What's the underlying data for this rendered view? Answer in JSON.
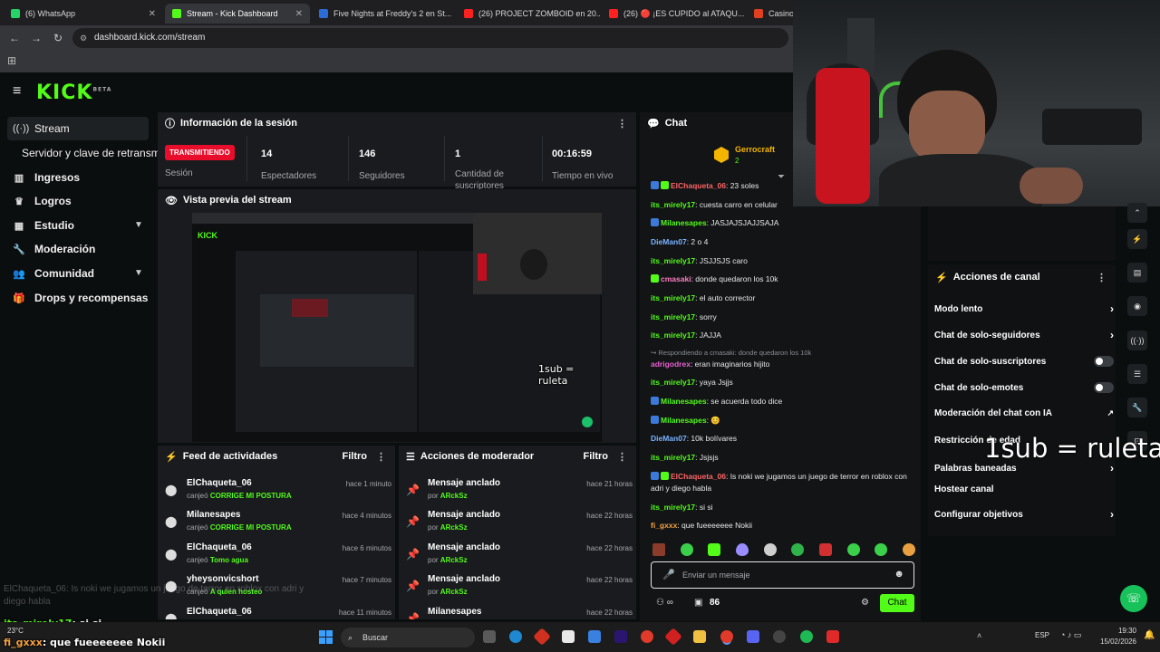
{
  "browser": {
    "tabs": [
      {
        "title": "(6) WhatsApp",
        "color": "#25d366"
      },
      {
        "title": "Stream - Kick Dashboard",
        "color": "#53fc18"
      },
      {
        "title": "Five Nights at Freddy's 2 en St...",
        "color": "#2a6cd8"
      },
      {
        "title": "(26) PROJECT ZOMBOID en 20...",
        "color": "#ff2020"
      },
      {
        "title": "(26) 🔴 ¡ES CUPIDO al ATAQU...",
        "color": "#ff2020"
      },
      {
        "title": "Casino Or",
        "color": "#e04020"
      }
    ],
    "url": "dashboard.kick.com/stream"
  },
  "kick": {
    "logo": "KICK",
    "beta": "BETA"
  },
  "sidebar": {
    "items": [
      {
        "label": "Stream",
        "icon": "broadcast-icon"
      },
      {
        "label": "Servidor y clave de retransmisión",
        "icon": ""
      },
      {
        "label": "Ingresos",
        "icon": "bank-icon"
      },
      {
        "label": "Logros",
        "icon": "trophy-icon"
      },
      {
        "label": "Estudio",
        "icon": "studio-icon"
      },
      {
        "label": "Moderación",
        "icon": "wrench-icon"
      },
      {
        "label": "Comunidad",
        "icon": "people-icon"
      },
      {
        "label": "Drops y recompensas",
        "icon": "gift-icon"
      }
    ]
  },
  "session": {
    "title": "Información de la sesión",
    "live_badge": "TRANSMITIENDO",
    "live_label": "Sesión",
    "stats": [
      {
        "value": "14",
        "label": "Espectadores"
      },
      {
        "value": "146",
        "label": "Seguidores"
      },
      {
        "value": "1",
        "label": "Cantidad de suscriptores"
      },
      {
        "value": "00:16:59",
        "label": "Tiempo en vivo"
      }
    ]
  },
  "preview": {
    "title": "Vista previa del stream",
    "overlay_text": "1sub = ruleta"
  },
  "feed": {
    "title": "Feed de actividades",
    "filter": "Filtro",
    "rows": [
      {
        "name": "ElChaqueta_06",
        "time": "hace 1 minuto",
        "action": "canjeó",
        "reward": "CORRIGE MI POSTURA"
      },
      {
        "name": "Milanesapes",
        "time": "hace 4 minutos",
        "action": "canjeó",
        "reward": "CORRIGE MI POSTURA"
      },
      {
        "name": "ElChaqueta_06",
        "time": "hace 6 minutos",
        "action": "canjeó",
        "reward": "Tomo agua"
      },
      {
        "name": "yheysonvicshort",
        "time": "hace 7 minutos",
        "action": "canjeó",
        "reward": "A quien hosteo"
      },
      {
        "name": "ElChaqueta_06",
        "time": "hace 11 minutos",
        "action": "",
        "reward": ""
      }
    ]
  },
  "modactions": {
    "title": "Acciones de moderador",
    "filter": "Filtro",
    "rows": [
      {
        "name": "Mensaje anclado",
        "time": "hace 21 horas",
        "by": "por",
        "user": "ARckSz"
      },
      {
        "name": "Mensaje anclado",
        "time": "hace 22 horas",
        "by": "por",
        "user": "ARckSz"
      },
      {
        "name": "Mensaje anclado",
        "time": "hace 22 horas",
        "by": "por",
        "user": "ARckSz"
      },
      {
        "name": "Mensaje anclado",
        "time": "hace 22 horas",
        "by": "por",
        "user": "ARckSz"
      },
      {
        "name": "Milanesapes",
        "time": "hace 22 horas",
        "by": "",
        "user": ""
      }
    ]
  },
  "chat": {
    "title": "Chat",
    "pinned_user": "Gerrocraft",
    "pinned_count": "2",
    "messages": [
      {
        "user": "ElChaqueta_06",
        "text": "23 soles",
        "cls": "r"
      },
      {
        "user": "its_mirely17",
        "text": "cuesta carro en celular",
        "cls": "g"
      },
      {
        "user": "Milanesapes",
        "text": "JASJAJSJAJJSAJA",
        "cls": "g"
      },
      {
        "user": "DieMan07",
        "text": "2 o 4",
        "cls": "b"
      },
      {
        "user": "its_mirely17",
        "text": "JSJJSJS caro",
        "cls": "g"
      },
      {
        "user": "cmasaki",
        "text": "donde quedaron los 10k",
        "cls": "pk"
      },
      {
        "user": "its_mirely17",
        "text": "el auto corrector",
        "cls": "g"
      },
      {
        "user": "its_mirely17",
        "text": "sorry",
        "cls": "g"
      },
      {
        "user": "its_mirely17",
        "text": "JAJJA",
        "cls": "g"
      },
      {
        "user": "adrigodrex",
        "text": "eran imaginarios hijito",
        "cls": "p"
      },
      {
        "user": "its_mirely17",
        "text": "yaya Jsjjs",
        "cls": "g"
      },
      {
        "user": "Milanesapes",
        "text": "se acuerda todo dice",
        "cls": "g"
      },
      {
        "user": "Milanesapes",
        "text": "😊",
        "cls": "g"
      },
      {
        "user": "DieMan07",
        "text": "10k bolívares",
        "cls": "b"
      },
      {
        "user": "its_mirely17",
        "text": "Jsjsjs",
        "cls": "g"
      },
      {
        "user": "ElChaqueta_06",
        "text": "Is noki we jugamos un juego de terror en roblox con adri y diego habla",
        "cls": "r"
      },
      {
        "user": "its_mirely17",
        "text": "si si",
        "cls": "g"
      },
      {
        "user": "fi_gxxx",
        "text": "que fueeeeeee Nokii",
        "cls": "o"
      }
    ],
    "reply_to": "Respondiendo a cmasaki: donde quedaron los 10k",
    "input_placeholder": "Enviar un mensaje",
    "points": "86",
    "send": "Chat"
  },
  "actions": {
    "title": "Acciones de canal",
    "items": [
      {
        "label": "Modo lento",
        "kind": "arrow"
      },
      {
        "label": "Chat de solo-seguidores",
        "kind": "arrow"
      },
      {
        "label": "Chat de solo-suscriptores",
        "kind": "toggle"
      },
      {
        "label": "Chat de solo-emotes",
        "kind": "toggle"
      },
      {
        "label": "Moderación del chat con IA",
        "kind": "link"
      },
      {
        "label": "Restricción de edad",
        "kind": "toggle"
      },
      {
        "label": "Palabras baneadas",
        "kind": "arrow"
      },
      {
        "label": "Hostear canal",
        "kind": "none"
      },
      {
        "label": "Configurar objetivos",
        "kind": "arrow"
      }
    ]
  },
  "overlay": {
    "big_text": "1sub = ruleta",
    "ghost_line1": "ElChaqueta_06: Is noki we jugamos un juego de terror en roblox con adri y",
    "ghost_line2": "diego habla",
    "line1_user": "its_mirely17",
    "line1_text": ": si si",
    "line2_user": "fi_gxxx",
    "line2_text": ": que fueeeeeee Nokii"
  },
  "taskbar": {
    "weather": "23°C",
    "search": "Buscar",
    "lang": "ESP",
    "time": "19:30",
    "date": "15/02/2026"
  }
}
